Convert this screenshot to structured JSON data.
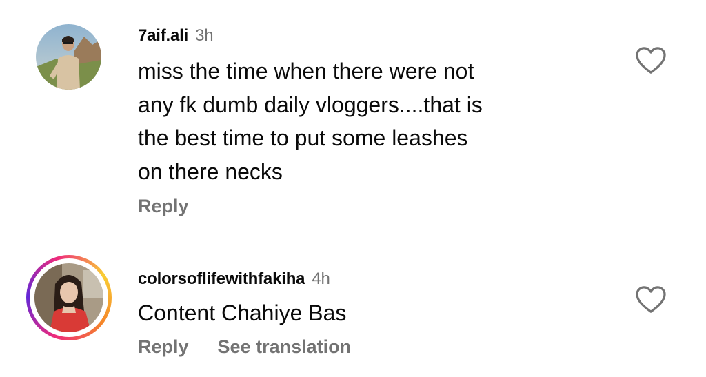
{
  "comments": [
    {
      "username": "7aif.ali",
      "time": "3h",
      "text": "miss the time when there were not\nany fk dumb daily vloggers....that is\nthe best time to put some leashes\non there necks",
      "reply_label": "Reply",
      "story_ring": false,
      "like_icon": "heart-outline-icon"
    },
    {
      "username": "colorsoflifewithfakiha",
      "time": "4h",
      "text": "Content Chahiye Bas",
      "reply_label": "Reply",
      "translation_label": "See translation",
      "story_ring": true,
      "like_icon": "heart-outline-icon"
    }
  ],
  "colors": {
    "text": "#0a0a0a",
    "secondary": "#737373",
    "story_ring_start": "#f9ce34",
    "story_ring_mid": "#ee2a7b",
    "story_ring_end": "#6228d7"
  }
}
